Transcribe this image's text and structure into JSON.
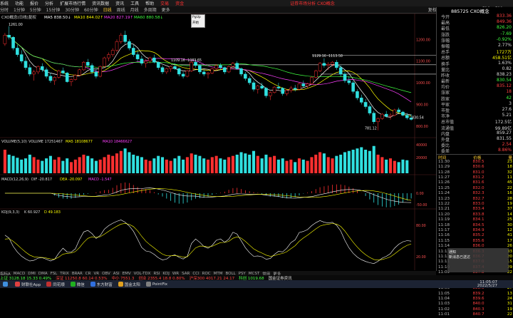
{
  "menubar": {
    "items": [
      "系统",
      "功能",
      "报价",
      "分析",
      "扩展市场行情",
      "资讯数据",
      "资讯",
      "工具",
      "帮助",
      "交易",
      "资金"
    ],
    "center_title": "证券市场分析 CXO概念"
  },
  "toolbar": {
    "items": [
      "分时",
      "1分钟",
      "5分钟",
      "15分钟",
      "30分钟",
      "60分钟",
      "日线",
      "周线",
      "月线",
      "多周期",
      "更多"
    ],
    "selected": "日线",
    "right_items": [
      "复权",
      "指标",
      "选股",
      "画线",
      "F10",
      "F11"
    ]
  },
  "main_chart": {
    "header": "CXO概念(日线)复权",
    "ma_labels": [
      "MA5 838.50↓",
      "MA10 844.02↑",
      "MA20 827.19↑",
      "MA60 880.58↓"
    ],
    "ma_colors": [
      "#ffffff",
      "#ffff00",
      "#ff40ff",
      "#40ff40"
    ],
    "price_annotations": [
      {
        "text": "1261.00",
        "x": 12,
        "price": 1261
      },
      {
        "text": "1109.16 -1083.65",
        "x": 240,
        "price": 1095
      },
      {
        "text": "1129.16 -1113.58",
        "x": 438,
        "price": 1115
      },
      {
        "text": "781.12",
        "x": 512,
        "price": 781
      },
      {
        "text": "830.54",
        "x": 578,
        "price": 830
      }
    ],
    "axis_labels": [
      "1200.00",
      "1100.00",
      "1000.00",
      "900.00",
      "800.00"
    ]
  },
  "volume_panel": {
    "header": "VOLUME(5,10)",
    "labels": [
      "VOLUME 17251467",
      "MA5 18108677",
      "MA10 18466627"
    ],
    "axis_labels": [
      "40000",
      "20000"
    ]
  },
  "macd_panel": {
    "header": "MACD(12,26,9)",
    "labels": [
      "DIF -20.817",
      "DEA -20.097",
      "MACD -1.547"
    ],
    "axis_labels": [
      "0.00",
      "-50.00"
    ]
  },
  "kdj_panel": {
    "header": "KDJ(9,3,3)",
    "labels": [
      "K 60.927",
      "D 49.183"
    ],
    "axis_labels": [
      "80.00",
      "20.00"
    ]
  },
  "chart_data": {
    "type": "candlestick",
    "title": "CXO概念(日线)复权",
    "ylim": [
      760,
      1280
    ],
    "ohlc": [
      [
        1180,
        1230,
        1170,
        1220
      ],
      [
        1220,
        1261,
        1200,
        1210
      ],
      [
        1210,
        1215,
        1150,
        1160
      ],
      [
        1160,
        1175,
        1120,
        1130
      ],
      [
        1130,
        1150,
        1090,
        1100
      ],
      [
        1100,
        1120,
        1060,
        1070
      ],
      [
        1070,
        1085,
        1030,
        1040
      ],
      [
        1040,
        1060,
        1010,
        1050
      ],
      [
        1050,
        1080,
        1040,
        1075
      ],
      [
        1075,
        1090,
        1050,
        1060
      ],
      [
        1060,
        1070,
        1020,
        1030
      ],
      [
        1030,
        1045,
        1000,
        1010
      ],
      [
        1010,
        1030,
        990,
        1025
      ],
      [
        1025,
        1060,
        1020,
        1055
      ],
      [
        1055,
        1070,
        1040,
        1045
      ],
      [
        1045,
        1050,
        1000,
        1005
      ],
      [
        1005,
        1020,
        985,
        1015
      ],
      [
        1015,
        1040,
        1010,
        1035
      ],
      [
        1035,
        1065,
        1030,
        1060
      ],
      [
        1060,
        1100,
        1055,
        1095
      ],
      [
        1095,
        1110,
        1070,
        1080
      ],
      [
        1080,
        1090,
        1040,
        1050
      ],
      [
        1050,
        1060,
        1020,
        1030
      ],
      [
        1030,
        1080,
        1025,
        1075
      ],
      [
        1075,
        1120,
        1070,
        1115
      ],
      [
        1115,
        1140,
        1100,
        1130
      ],
      [
        1130,
        1160,
        1120,
        1150
      ],
      [
        1150,
        1200,
        1140,
        1190
      ],
      [
        1190,
        1230,
        1180,
        1220
      ],
      [
        1220,
        1240,
        1180,
        1190
      ],
      [
        1190,
        1200,
        1150,
        1160
      ],
      [
        1160,
        1175,
        1120,
        1130
      ],
      [
        1130,
        1145,
        1100,
        1110
      ],
      [
        1110,
        1125,
        1080,
        1090
      ],
      [
        1090,
        1110,
        1070,
        1100
      ],
      [
        1100,
        1120,
        1090,
        1115
      ],
      [
        1115,
        1130,
        1090,
        1095
      ],
      [
        1095,
        1100,
        1060,
        1070
      ],
      [
        1070,
        1080,
        1040,
        1050
      ],
      [
        1050,
        1070,
        1040,
        1065
      ],
      [
        1065,
        1080,
        1050,
        1075
      ],
      [
        1075,
        1090,
        1060,
        1065
      ],
      [
        1065,
        1070,
        1030,
        1040
      ],
      [
        1040,
        1050,
        1020,
        1030
      ],
      [
        1030,
        1060,
        1025,
        1055
      ],
      [
        1055,
        1100,
        1050,
        1095
      ],
      [
        1095,
        1105,
        1070,
        1080
      ],
      [
        1080,
        1085,
        1040,
        1050
      ],
      [
        1050,
        1060,
        1030,
        1040
      ],
      [
        1040,
        1050,
        1020,
        1045
      ],
      [
        1045,
        1070,
        1040,
        1065
      ],
      [
        1065,
        1085,
        1055,
        1080
      ],
      [
        1080,
        1090,
        1060,
        1070
      ],
      [
        1070,
        1075,
        1040,
        1050
      ],
      [
        1050,
        1080,
        1045,
        1075
      ],
      [
        1075,
        1095,
        1070,
        1090
      ],
      [
        1090,
        1100,
        1060,
        1065
      ],
      [
        1065,
        1070,
        1030,
        1040
      ],
      [
        1040,
        1050,
        1010,
        1020
      ],
      [
        1020,
        1030,
        990,
        1000
      ],
      [
        1000,
        1010,
        960,
        970
      ],
      [
        970,
        990,
        950,
        985
      ],
      [
        985,
        1000,
        970,
        975
      ],
      [
        975,
        980,
        930,
        940
      ],
      [
        940,
        960,
        920,
        955
      ],
      [
        955,
        985,
        950,
        980
      ],
      [
        980,
        1000,
        970,
        975
      ],
      [
        975,
        980,
        940,
        950
      ],
      [
        950,
        970,
        940,
        965
      ],
      [
        965,
        985,
        955,
        975
      ],
      [
        975,
        990,
        960,
        970
      ],
      [
        970,
        1000,
        965,
        995
      ],
      [
        995,
        1010,
        980,
        985
      ],
      [
        985,
        1000,
        975,
        995
      ],
      [
        995,
        1030,
        990,
        1025
      ],
      [
        1025,
        1060,
        1020,
        1055
      ],
      [
        1055,
        1095,
        1050,
        1090
      ],
      [
        1090,
        1113,
        1070,
        1080
      ],
      [
        1080,
        1095,
        1060,
        1085
      ],
      [
        1085,
        1100,
        1075,
        1095
      ],
      [
        1095,
        1105,
        1060,
        1070
      ],
      [
        1070,
        1080,
        1030,
        1040
      ],
      [
        1040,
        1050,
        1000,
        1010
      ],
      [
        1010,
        1030,
        990,
        1000
      ],
      [
        1000,
        1010,
        950,
        960
      ],
      [
        960,
        970,
        920,
        930
      ],
      [
        930,
        945,
        900,
        910
      ],
      [
        910,
        925,
        880,
        890
      ],
      [
        890,
        900,
        850,
        860
      ],
      [
        860,
        870,
        810,
        820
      ],
      [
        820,
        840,
        781,
        835
      ],
      [
        835,
        860,
        830,
        855
      ],
      [
        855,
        870,
        840,
        845
      ],
      [
        845,
        860,
        830,
        850
      ],
      [
        850,
        880,
        845,
        875
      ],
      [
        875,
        885,
        860,
        865
      ],
      [
        865,
        870,
        845,
        850
      ],
      [
        850,
        860,
        830,
        838
      ],
      [
        838,
        855,
        826,
        831
      ]
    ],
    "volume": [
      38,
      30,
      28,
      25,
      22,
      24,
      30,
      26,
      22,
      20,
      24,
      28,
      22,
      26,
      20,
      24,
      18,
      22,
      26,
      30,
      28,
      24,
      20,
      22,
      26,
      30,
      28,
      32,
      36,
      40,
      34,
      30,
      28,
      26,
      22,
      20,
      24,
      28,
      26,
      22,
      20,
      24,
      28,
      22,
      26,
      32,
      30,
      28,
      24,
      22,
      26,
      28,
      24,
      22,
      26,
      28,
      30,
      34,
      32,
      30,
      36,
      28,
      24,
      30,
      26,
      28,
      22,
      24,
      20,
      22,
      18,
      24,
      22,
      20,
      26,
      30,
      34,
      32,
      26,
      24,
      28,
      30,
      34,
      36,
      38,
      40,
      42,
      38,
      36,
      44,
      30,
      26,
      22,
      24,
      20,
      18,
      22,
      21
    ],
    "ma_series": [
      {
        "name": "MA5",
        "color": "#ffffff"
      },
      {
        "name": "MA10",
        "color": "#ffff00"
      },
      {
        "name": "MA20",
        "color": "#ff40ff"
      },
      {
        "name": "MA60",
        "color": "#40ff40"
      }
    ]
  },
  "right_panel": {
    "title": "885725 CXO概念",
    "rows": [
      {
        "label": "今开",
        "value": "833.36",
        "color": "#ff4040"
      },
      {
        "label": "最高",
        "value": "849.36",
        "color": "#ff4040"
      },
      {
        "label": "最低",
        "value": "826.20",
        "color": "#40ff40"
      },
      {
        "label": "涨跌",
        "value": "-7.69",
        "color": "#40ff40"
      },
      {
        "label": "涨幅",
        "value": "-0.92%",
        "color": "#40ff40"
      },
      {
        "label": "振幅",
        "value": "2.77%",
        "color": "#ddd"
      },
      {
        "label": "总手",
        "value": "1727万",
        "color": "#ffff00"
      },
      {
        "label": "总额",
        "value": "458.51亿",
        "color": "#ffff00"
      },
      {
        "label": "换手",
        "value": "1.63%",
        "color": "#ddd"
      },
      {
        "label": "量比",
        "value": "0.82",
        "color": "#ddd"
      },
      {
        "label": "昨收",
        "value": "838.23",
        "color": "#ddd"
      },
      {
        "label": "最新",
        "value": "830.54",
        "color": "#40ff40"
      },
      {
        "label": "均价",
        "value": "835.12",
        "color": "#ff4040"
      },
      {
        "label": "涨家",
        "value": "18",
        "color": "#ff4040"
      },
      {
        "label": "跌家",
        "value": "42",
        "color": "#40ff40"
      },
      {
        "label": "平家",
        "value": "3",
        "color": "#ddd"
      },
      {
        "label": "市盈",
        "value": "27.6",
        "color": "#ddd"
      },
      {
        "label": "市净",
        "value": "5.21",
        "color": "#ddd"
      },
      {
        "label": "总市值",
        "value": "172.5亿",
        "color": "#ddd"
      },
      {
        "label": "流通值",
        "value": "99.89亿",
        "color": "#ddd"
      },
      {
        "label": "内盘",
        "value": "859.27",
        "color": "#ddd"
      },
      {
        "label": "外盘",
        "value": "831.55",
        "color": "#ddd"
      },
      {
        "label": "委比",
        "value": "2.54",
        "color": "#ff4040"
      },
      {
        "label": "委差",
        "value": "8.86%",
        "color": "#ff4040"
      }
    ],
    "ticks_header": [
      "时间",
      "价格",
      "量"
    ],
    "ticks": [
      [
        "11:30",
        "830.5",
        "23"
      ],
      [
        "11:29",
        "830.6",
        "18"
      ],
      [
        "11:28",
        "831.0",
        "32"
      ],
      [
        "11:27",
        "831.2",
        "11"
      ],
      [
        "11:26",
        "831.6",
        "45"
      ],
      [
        "11:25",
        "832.0",
        "22"
      ],
      [
        "11:24",
        "832.3",
        "16"
      ],
      [
        "11:23",
        "832.7",
        "28"
      ],
      [
        "11:22",
        "833.0",
        "19"
      ],
      [
        "11:21",
        "833.4",
        "37"
      ],
      [
        "11:20",
        "833.8",
        "14"
      ],
      [
        "11:19",
        "834.1",
        "25"
      ],
      [
        "11:18",
        "834.5",
        "30"
      ],
      [
        "11:17",
        "834.9",
        "12"
      ],
      [
        "11:16",
        "835.2",
        "41"
      ],
      [
        "11:15",
        "835.6",
        "17"
      ],
      [
        "11:14",
        "836.0",
        "26"
      ],
      [
        "11:13",
        "836.3",
        "33"
      ],
      [
        "11:12",
        "836.7",
        "20"
      ],
      [
        "11:11",
        "837.0",
        "15"
      ],
      [
        "11:10",
        "837.4",
        "29"
      ],
      [
        "11:09",
        "837.8",
        "22"
      ],
      [
        "11:08",
        "838.1",
        "18"
      ],
      [
        "11:07",
        "838.5",
        "35"
      ],
      [
        "11:06",
        "838.9",
        "27"
      ],
      [
        "11:05",
        "839.2",
        "13"
      ],
      [
        "11:04",
        "839.6",
        "24"
      ],
      [
        "11:03",
        "840.0",
        "31"
      ],
      [
        "11:02",
        "840.3",
        "19"
      ],
      [
        "11:01",
        "840.7",
        "22"
      ]
    ]
  },
  "bottom_tabs": [
    "指标A",
    "MACD",
    "DMI",
    "DMA",
    "FSL",
    "TRIX",
    "BRAR",
    "CR",
    "VR",
    "OBV",
    "ASI",
    "EMV",
    "VOL-TDX",
    "RSI",
    "KDJ",
    "WR",
    "SAR",
    "CCI",
    "ROC",
    "MTM",
    "BOLL",
    "PSY",
    "MCST",
    "常用",
    "更多"
  ],
  "status": [
    {
      "text": "上证 3128.18 15.33 0.49%",
      "color": "#40ff40"
    },
    {
      "text": "深证 11250.8 60.14 0.53%",
      "color": "#ff4040"
    },
    {
      "text": "中小 7551.3 ",
      "color": "#ff4040"
    },
    {
      "text": "创业 2355.4 18.8 0.80%",
      "color": "#ff4040"
    },
    {
      "text": "沪深300 4017.21 24.17",
      "color": "#ff4040"
    },
    {
      "text": "科创 1019.68",
      "color": "#40ff40"
    },
    {
      "text": "国金证券资讯",
      "color": "#ddd"
    }
  ],
  "taskbar": {
    "items": [
      {
        "label": "财联社App",
        "color": "#e04040"
      },
      {
        "label": "同花顺",
        "color": "#c03030"
      },
      {
        "label": "微信",
        "color": "#20b020"
      },
      {
        "label": "东方财富",
        "color": "#3070e0"
      },
      {
        "label": "国金太阳",
        "color": "#e0a020"
      },
      {
        "label": "PointFix",
        "color": "#808080"
      }
    ],
    "time": "11:05:07",
    "date": "2022/5/27"
  },
  "popup": {
    "line1": "PgUp",
    "line2": "开始"
  },
  "notification": {
    "line1": "通知",
    "line2": "新消息已送达"
  }
}
